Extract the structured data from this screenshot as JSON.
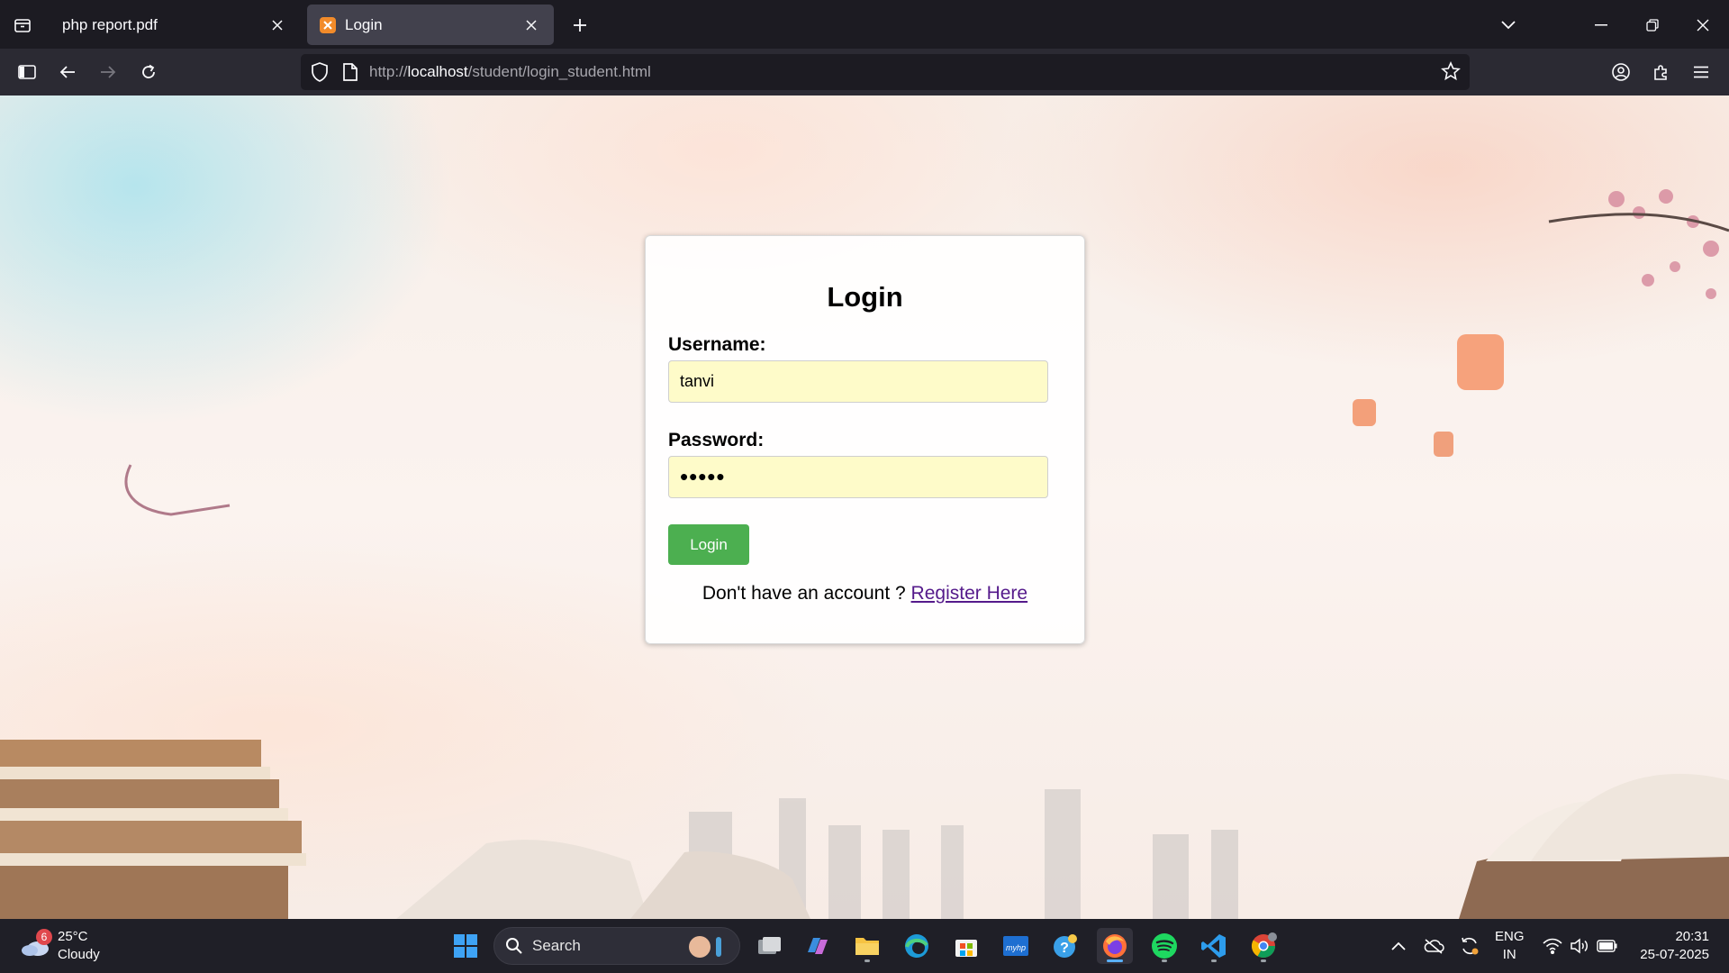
{
  "browser": {
    "tabs": [
      {
        "title": "php report.pdf",
        "active": false
      },
      {
        "title": "Login",
        "active": true
      }
    ],
    "url": {
      "scheme": "http://",
      "host": "localhost",
      "path": "/student/login_student.html"
    }
  },
  "page": {
    "heading": "Login",
    "username_label": "Username:",
    "username_value": "tanvi",
    "password_label": "Password:",
    "password_mask": "•••••",
    "login_button": "Login",
    "register_prompt": "Don't have an account ? ",
    "register_link": "Register Here"
  },
  "taskbar": {
    "weather": {
      "temp": "25°C",
      "condition": "Cloudy",
      "badge": "6"
    },
    "search_placeholder": "Search",
    "language": {
      "line1": "ENG",
      "line2": "IN"
    },
    "clock": {
      "time": "20:31",
      "date": "25-07-2025"
    }
  },
  "colors": {
    "login_button": "#4caf50",
    "input_bg": "#fefbc9",
    "link": "#551a8b",
    "tab_active": "#42414d",
    "toolbar": "#2b2a33"
  }
}
